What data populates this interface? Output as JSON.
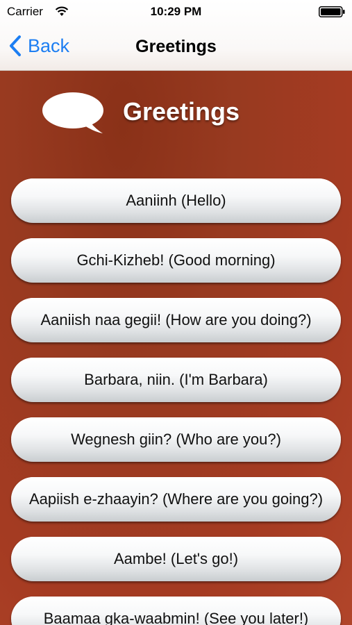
{
  "status_bar": {
    "carrier": "Carrier",
    "time": "10:29 PM"
  },
  "nav": {
    "back_label": "Back",
    "title": "Greetings"
  },
  "header": {
    "title": "Greetings"
  },
  "phrases": [
    "Aaniinh (Hello)",
    "Gchi-Kizheb! (Good morning)",
    "Aaniish naa gegii! (How are you doing?)",
    "Barbara, niin. (I'm Barbara)",
    "Wegnesh giin? (Who are you?)",
    "Aapiish e-zhaayin? (Where are you going?)",
    "Aambe! (Let's go!)",
    "Baamaa gka-waabmin! (See you later!)"
  ],
  "colors": {
    "accent": "#1d7ef2",
    "background": "#a53b22"
  }
}
